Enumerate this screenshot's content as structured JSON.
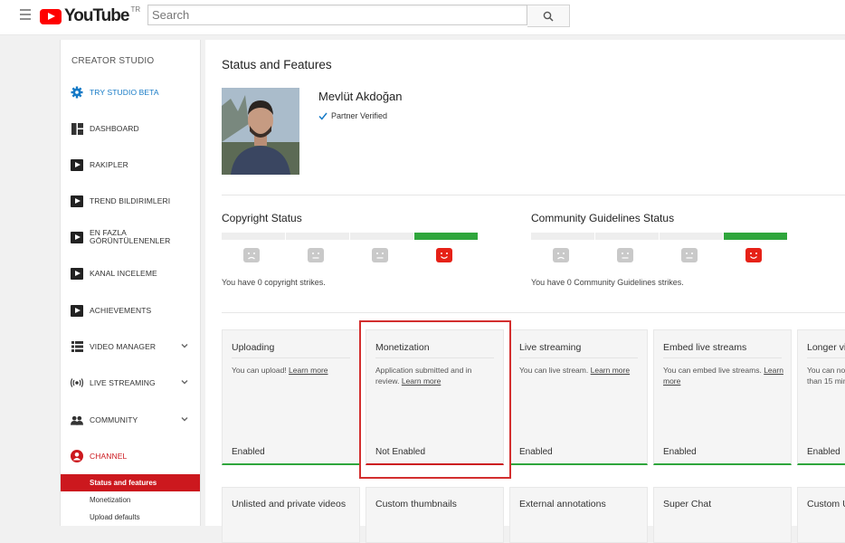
{
  "header": {
    "logo_text": "YouTube",
    "logo_country": "TR",
    "search_placeholder": "Search",
    "icons": {
      "menu": "hamburger-icon",
      "search": "search-icon"
    }
  },
  "sidebar": {
    "title": "CREATOR STUDIO",
    "items": [
      {
        "label": "TRY STUDIO BETA",
        "icon": "gear-icon"
      },
      {
        "label": "DASHBOARD",
        "icon": "dashboard-icon"
      },
      {
        "label": "RAKIPLER",
        "icon": "vidiq-icon"
      },
      {
        "label": "TREND BILDIRIMLERI",
        "icon": "vidiq-icon"
      },
      {
        "label": "EN FAZLA GÖRÜNTÜLENENLER",
        "icon": "vidiq-icon"
      },
      {
        "label": "KANAL INCELEME",
        "icon": "vidiq-icon"
      },
      {
        "label": "ACHIEVEMENTS",
        "icon": "vidiq-icon"
      },
      {
        "label": "VIDEO MANAGER",
        "icon": "video-manager-icon"
      },
      {
        "label": "LIVE STREAMING",
        "icon": "live-icon"
      },
      {
        "label": "COMMUNITY",
        "icon": "community-icon"
      },
      {
        "label": "CHANNEL",
        "icon": "channel-icon"
      }
    ],
    "sub_items": [
      "Status and features",
      "Monetization",
      "Upload defaults"
    ]
  },
  "main": {
    "title": "Status and Features",
    "channel_name": "Mevlüt Akdoğan",
    "verified_text": "Partner Verified",
    "copyright": {
      "title": "Copyright Status",
      "text": "You have 0 copyright strikes."
    },
    "community": {
      "title": "Community Guidelines Status",
      "text": "You have 0 Community Guidelines strikes."
    },
    "cards": [
      {
        "title": "Uploading",
        "desc": "You can upload!",
        "link": "Learn more",
        "status": "Enabled"
      },
      {
        "title": "Monetization",
        "desc": "Application submitted and in review.",
        "link": "Learn more",
        "status": "Not Enabled"
      },
      {
        "title": "Live streaming",
        "desc": "You can live stream.",
        "link": "Learn more",
        "status": "Enabled"
      },
      {
        "title": "Embed live streams",
        "desc": "You can embed live streams.",
        "link": "Learn more",
        "status": "Enabled"
      },
      {
        "title": "Longer vi",
        "desc": "You can no",
        "desc2": "than 15 min",
        "status": "Enabled"
      }
    ],
    "cards_row2": [
      "Unlisted and private videos",
      "Custom thumbnails",
      "External annotations",
      "Super Chat",
      "Custom U"
    ]
  }
}
